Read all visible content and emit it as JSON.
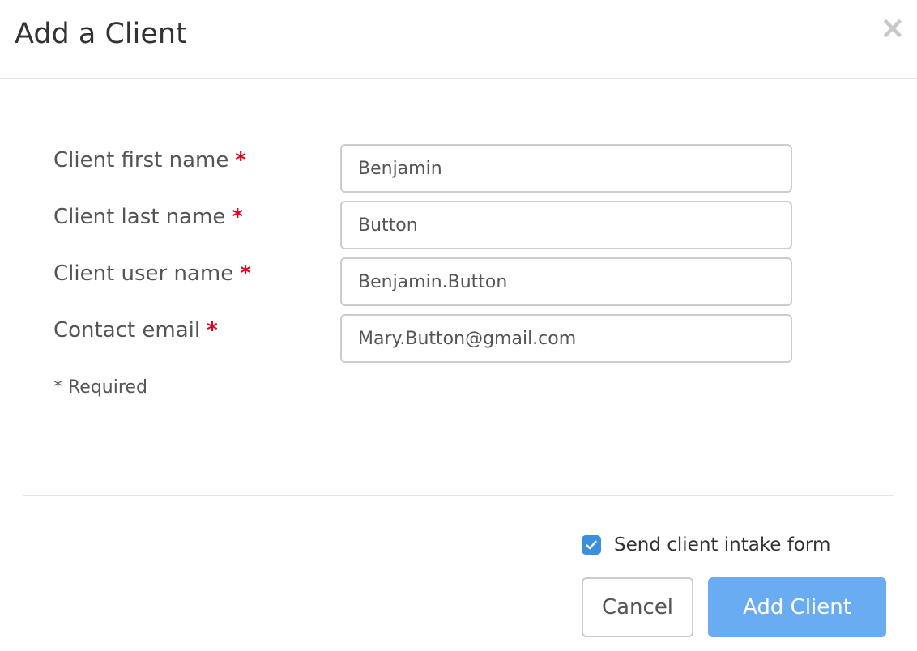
{
  "dialog": {
    "title": "Add a Client",
    "close_glyph": "×"
  },
  "form": {
    "fields": [
      {
        "label": "Client first name",
        "value": "Benjamin",
        "required_mark": "*"
      },
      {
        "label": "Client last name",
        "value": "Button",
        "required_mark": "*"
      },
      {
        "label": "Client user name",
        "value": "Benjamin.Button",
        "required_mark": "*"
      },
      {
        "label": "Contact email",
        "value": "Mary.Button@gmail.com",
        "required_mark": "*"
      }
    ],
    "required_note": "* Required"
  },
  "footer": {
    "send_intake": {
      "label": "Send client intake form",
      "checked": true
    },
    "cancel_label": "Cancel",
    "submit_label": "Add Client"
  },
  "colors": {
    "required_star": "#e0001b",
    "checkbox": "#3d8fd9",
    "primary_button": "#6aacf1"
  },
  "icons": {
    "close": "close-icon",
    "checkmark": "checkmark-icon"
  }
}
